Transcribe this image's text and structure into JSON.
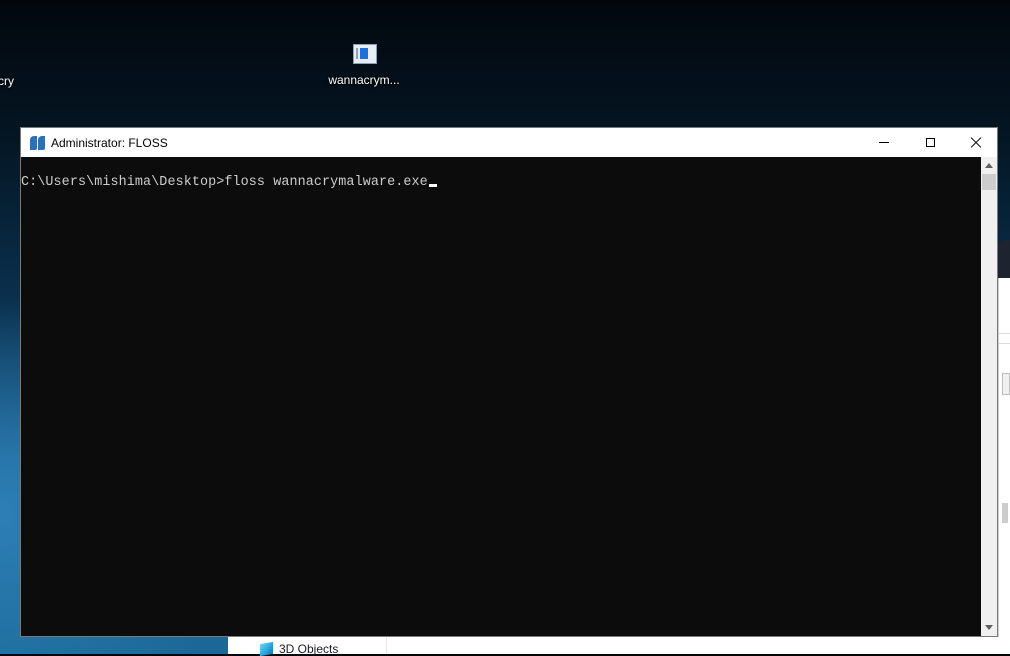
{
  "desktop": {
    "icons": [
      {
        "label": "cry",
        "icon": "app-icon"
      },
      {
        "label": "wannacrym...",
        "icon": "executable-icon"
      }
    ]
  },
  "console_window": {
    "title": "Administrator: FLOSS",
    "title_icon": "floss-quote-icon",
    "prompt_line": "C:\\Users\\mishima\\Desktop>floss wannacrymalware.exe",
    "colors": {
      "background": "#0c0c0c",
      "text": "#cccccc"
    }
  },
  "background_explorer": {
    "nav_item": "3D Objects"
  }
}
